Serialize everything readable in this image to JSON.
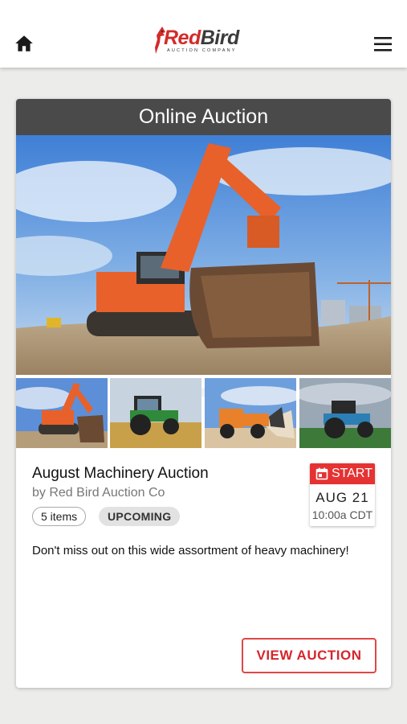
{
  "header": {
    "logo_word_red": "Red",
    "logo_word_dark": "Bird",
    "logo_subtitle": "AUCTION COMPANY"
  },
  "card": {
    "type_label": "Online Auction",
    "title": "August Machinery Auction",
    "byline": "by Red Bird Auction Co",
    "items_count": "5 items",
    "status": "UPCOMING",
    "date": {
      "label": "START",
      "day": "AUG 21",
      "time": "10:00a CDT"
    },
    "description": "Don't miss out on this wide assortment of heavy machinery!",
    "button_label": "VIEW AUCTION",
    "carousel": {
      "active_index": 1,
      "total": 5
    },
    "thumbnails": [
      "excavator",
      "green tractor",
      "wheel loader",
      "blue tractor"
    ]
  },
  "colors": {
    "brand_red": "#d42a2a",
    "header_gray": "#4a4a4a",
    "machine_orange": "#e8612a"
  }
}
